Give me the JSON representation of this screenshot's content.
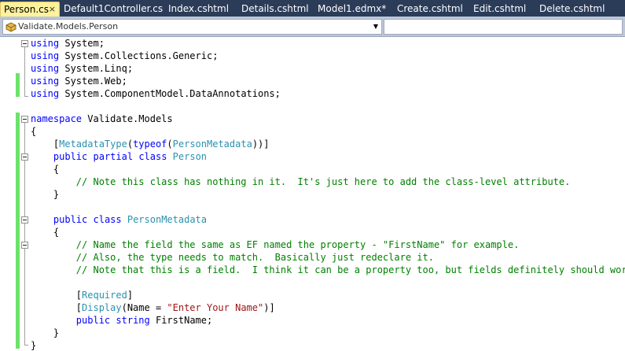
{
  "tabs": [
    {
      "label": "Person.cs",
      "active": true
    },
    {
      "label": "Default1Controller.cs",
      "active": false
    },
    {
      "label": "Index.cshtml",
      "active": false
    },
    {
      "label": "Details.cshtml",
      "active": false
    },
    {
      "label": "Model1.edmx*",
      "active": false
    },
    {
      "label": "Create.cshtml",
      "active": false
    },
    {
      "label": "Edit.cshtml",
      "active": false
    },
    {
      "label": "Delete.cshtml",
      "active": false
    }
  ],
  "tab_close_glyph": "×",
  "navbar": {
    "type_selector": "Validate.Models.Person",
    "member_selector": ""
  },
  "colors": {
    "keyword": "#0000ff",
    "type": "#2b91af",
    "comment": "#008000",
    "string": "#a31515",
    "change_marker": "#6ce26c",
    "active_tab": "#fff29d",
    "tab_strip": "#2b3c59"
  },
  "code_lines": [
    [
      {
        "k": "kw",
        "t": "using"
      },
      {
        "k": "pl",
        "t": " System;"
      }
    ],
    [
      {
        "k": "kw",
        "t": "using"
      },
      {
        "k": "pl",
        "t": " System.Collections.Generic;"
      }
    ],
    [
      {
        "k": "kw",
        "t": "using"
      },
      {
        "k": "pl",
        "t": " System.Linq;"
      }
    ],
    [
      {
        "k": "kw",
        "t": "using"
      },
      {
        "k": "pl",
        "t": " System.Web;"
      }
    ],
    [
      {
        "k": "kw",
        "t": "using"
      },
      {
        "k": "pl",
        "t": " System.ComponentModel.DataAnnotations;"
      }
    ],
    [],
    [
      {
        "k": "kw",
        "t": "namespace"
      },
      {
        "k": "pl",
        "t": " Validate.Models"
      }
    ],
    [
      {
        "k": "pl",
        "t": "{"
      }
    ],
    [
      {
        "k": "pl",
        "t": "    ["
      },
      {
        "k": "ty",
        "t": "MetadataType"
      },
      {
        "k": "pl",
        "t": "("
      },
      {
        "k": "kw",
        "t": "typeof"
      },
      {
        "k": "pl",
        "t": "("
      },
      {
        "k": "ty",
        "t": "PersonMetadata"
      },
      {
        "k": "pl",
        "t": "))]"
      }
    ],
    [
      {
        "k": "pl",
        "t": "    "
      },
      {
        "k": "kw",
        "t": "public"
      },
      {
        "k": "pl",
        "t": " "
      },
      {
        "k": "kw",
        "t": "partial"
      },
      {
        "k": "pl",
        "t": " "
      },
      {
        "k": "kw",
        "t": "class"
      },
      {
        "k": "pl",
        "t": " "
      },
      {
        "k": "ty",
        "t": "Person"
      }
    ],
    [
      {
        "k": "pl",
        "t": "    {"
      }
    ],
    [
      {
        "k": "pl",
        "t": "        "
      },
      {
        "k": "cm",
        "t": "// Note this class has nothing in it.  It's just here to add the class-level attribute."
      }
    ],
    [
      {
        "k": "pl",
        "t": "    }"
      }
    ],
    [],
    [
      {
        "k": "pl",
        "t": "    "
      },
      {
        "k": "kw",
        "t": "public"
      },
      {
        "k": "pl",
        "t": " "
      },
      {
        "k": "kw",
        "t": "class"
      },
      {
        "k": "pl",
        "t": " "
      },
      {
        "k": "ty",
        "t": "PersonMetadata"
      }
    ],
    [
      {
        "k": "pl",
        "t": "    {"
      }
    ],
    [
      {
        "k": "pl",
        "t": "        "
      },
      {
        "k": "cm",
        "t": "// Name the field the same as EF named the property - \"FirstName\" for example."
      }
    ],
    [
      {
        "k": "pl",
        "t": "        "
      },
      {
        "k": "cm",
        "t": "// Also, the type needs to match.  Basically just redeclare it."
      }
    ],
    [
      {
        "k": "pl",
        "t": "        "
      },
      {
        "k": "cm",
        "t": "// Note that this is a field.  I think it can be a property too, but fields definitely should work."
      }
    ],
    [],
    [
      {
        "k": "pl",
        "t": "        ["
      },
      {
        "k": "ty",
        "t": "Required"
      },
      {
        "k": "pl",
        "t": "]"
      }
    ],
    [
      {
        "k": "pl",
        "t": "        ["
      },
      {
        "k": "ty",
        "t": "Display"
      },
      {
        "k": "pl",
        "t": "(Name = "
      },
      {
        "k": "st",
        "t": "\"Enter Your Name\""
      },
      {
        "k": "pl",
        "t": ")]"
      }
    ],
    [
      {
        "k": "pl",
        "t": "        "
      },
      {
        "k": "kw",
        "t": "public"
      },
      {
        "k": "pl",
        "t": " "
      },
      {
        "k": "kw",
        "t": "string"
      },
      {
        "k": "pl",
        "t": " FirstName;"
      }
    ],
    [
      {
        "k": "pl",
        "t": "    }"
      }
    ],
    [
      {
        "k": "pl",
        "t": "}"
      }
    ]
  ]
}
